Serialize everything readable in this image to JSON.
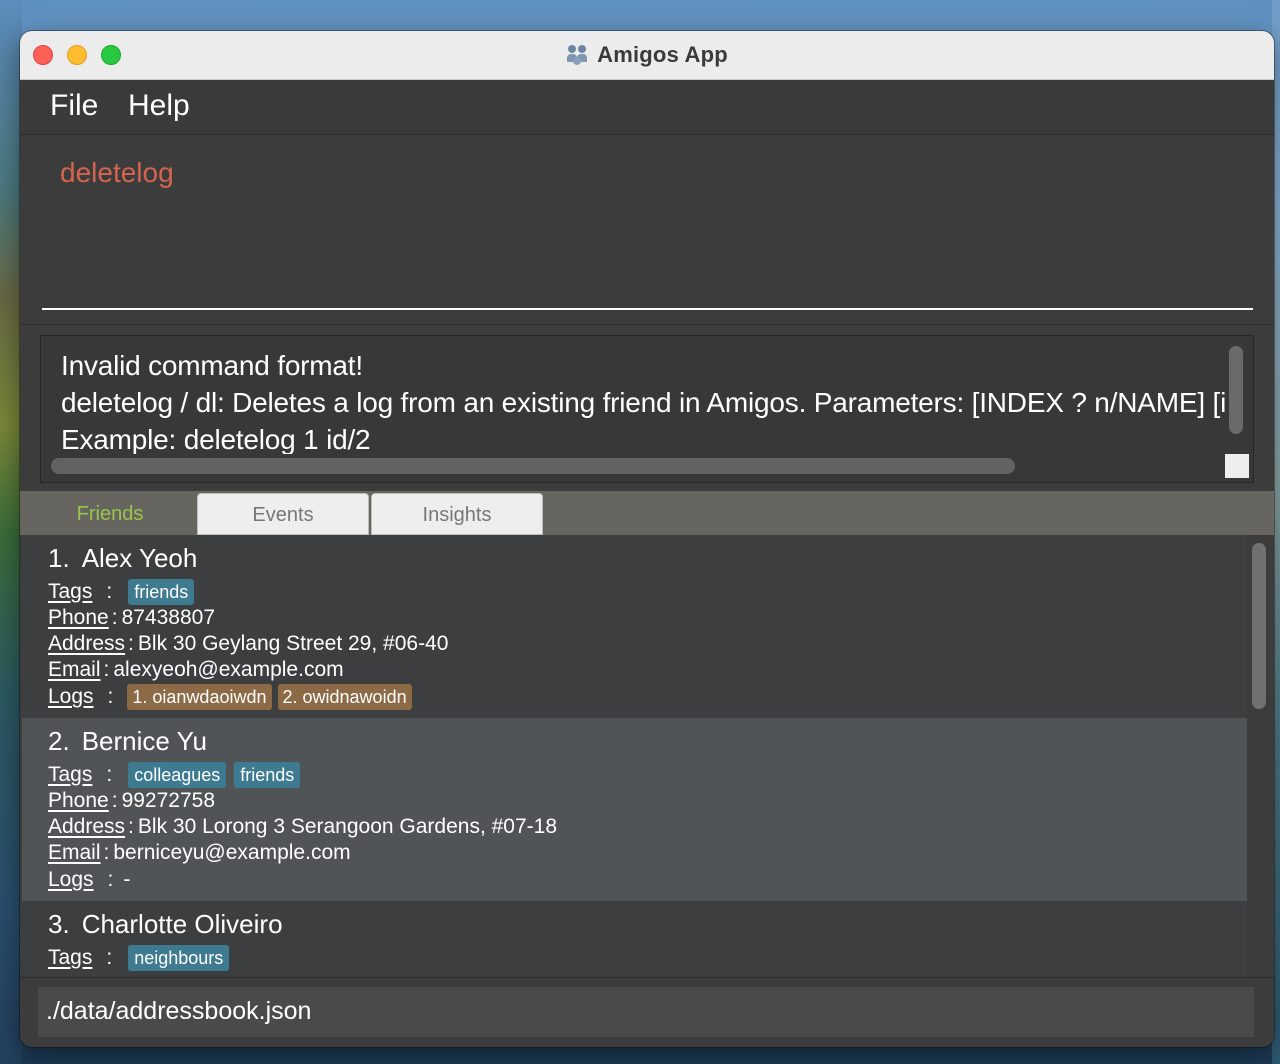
{
  "window": {
    "title": "Amigos App"
  },
  "menu": {
    "file": "File",
    "help": "Help"
  },
  "command": {
    "value": "deletelog"
  },
  "result": {
    "lines": [
      "Invalid command format!",
      "deletelog / dl: Deletes a log from an existing friend in Amigos. Parameters: [INDEX ? n/NAME] [id",
      "Example: deletelog 1 id/2"
    ]
  },
  "tabs": [
    {
      "label": "Friends"
    },
    {
      "label": "Events"
    },
    {
      "label": "Insights"
    }
  ],
  "field_labels": {
    "tags": "Tags",
    "phone": "Phone",
    "address": "Address",
    "email": "Email",
    "logs": "Logs"
  },
  "friends": [
    {
      "index": "1.",
      "name": "Alex Yeoh",
      "tags": [
        "friends"
      ],
      "phone": "87438807",
      "address": "Blk 30 Geylang Street 29, #06-40",
      "email": "alexyeoh@example.com",
      "logs": [
        "1. oianwdaoiwdn",
        "2. owidnawoidn"
      ]
    },
    {
      "index": "2.",
      "name": "Bernice Yu",
      "tags": [
        "colleagues",
        "friends"
      ],
      "phone": "99272758",
      "address": "Blk 30 Lorong 3 Serangoon Gardens, #07-18",
      "email": "berniceyu@example.com",
      "logs_text": "-"
    },
    {
      "index": "3.",
      "name": "Charlotte Oliveiro",
      "tags": [
        "neighbours"
      ]
    }
  ],
  "status": {
    "path": "./data/addressbook.json"
  },
  "colors": {
    "command_text": "#d5644f",
    "tab_active": "#9ac44a",
    "tag_bg": "#3e7b91",
    "log_bg": "#8c6a45",
    "selected_row_bg": "#515457"
  }
}
